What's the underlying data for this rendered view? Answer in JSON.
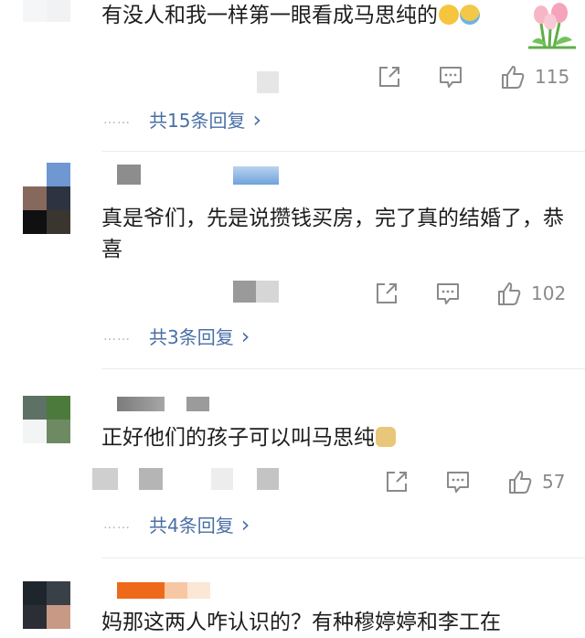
{
  "comments": [
    {
      "text": "有没人和我一样第一眼看成马思纯的",
      "likes": "115",
      "replies": "共15条回复",
      "dots": "……",
      "chevron": "›"
    },
    {
      "text": "真是爷们，先是说攒钱买房，完了真的结婚了，恭喜",
      "likes": "102",
      "replies": "共3条回复",
      "dots": "……",
      "chevron": "›"
    },
    {
      "text": "正好他们的孩子可以叫马思纯",
      "likes": "57",
      "replies": "共4条回复",
      "dots": "……",
      "chevron": "›"
    },
    {
      "text": "妈那这两人咋认识的？有种穆婷婷和李工在"
    }
  ],
  "icons": {
    "share": "share-icon",
    "comment": "comment-icon",
    "like": "like-icon",
    "emoji_laugh": "laughing-emoji-icon",
    "emoji_cry": "crying-laughing-emoji-icon",
    "emoji_doge": "doge-emoji-icon",
    "flower": "tulip-sticker-icon"
  },
  "colors": {
    "link": "#4a6fa5",
    "icon": "#8a8a8a",
    "divider": "#ececec"
  }
}
